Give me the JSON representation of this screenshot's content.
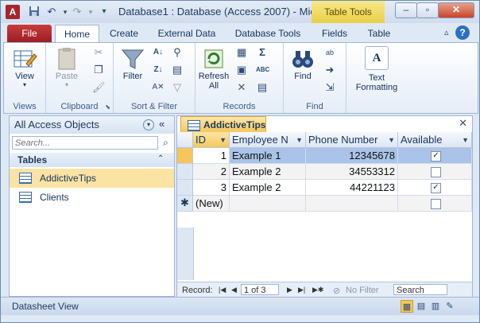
{
  "window": {
    "title": "Database1 : Database (Access 2007)  -  Mic...",
    "context_tab": "Table Tools",
    "app_icon": "A",
    "min_label": "–",
    "max_label": "▫",
    "close_label": "✕"
  },
  "qat": {
    "save_icon": "save-icon",
    "undo_icon": "undo-icon",
    "redo_icon": "redo-icon",
    "customize_icon": "customize-qat-icon"
  },
  "tabs": {
    "file": "File",
    "home": "Home",
    "create": "Create",
    "external": "External Data",
    "dbtools": "Database Tools",
    "fields": "Fields",
    "table": "Table"
  },
  "help_label": "?",
  "ribbon": {
    "views": {
      "view": "View",
      "label": "Views"
    },
    "clipboard": {
      "paste": "Paste",
      "label": "Clipboard"
    },
    "sortfilter": {
      "filter": "Filter",
      "label": "Sort & Filter"
    },
    "records": {
      "refresh": "Refresh All",
      "label": "Records"
    },
    "find": {
      "find": "Find",
      "label": "Find"
    },
    "textfmt": {
      "text_formatting": "Text Formatting",
      "a_label": "A"
    }
  },
  "nav": {
    "title": "All Access Objects",
    "search_placeholder": "Search...",
    "group": "Tables",
    "items": [
      {
        "label": "AddictiveTips"
      },
      {
        "label": "Clients"
      }
    ]
  },
  "datasheet": {
    "tab_label": "AddictiveTips",
    "columns": [
      "ID",
      "Employee N",
      "Phone Number",
      "Available"
    ],
    "rows": [
      {
        "id": "1",
        "name": "Example 1",
        "phone": "12345678",
        "available": true
      },
      {
        "id": "2",
        "name": "Example 2",
        "phone": "34553312",
        "available": false
      },
      {
        "id": "3",
        "name": "Example 2",
        "phone": "44221123",
        "available": true
      }
    ],
    "new_row": "(New)",
    "new_marker": "✱",
    "record_label": "Record:",
    "record_pos": "1 of 3",
    "no_filter": "No Filter",
    "search": "Search"
  },
  "status": {
    "text": "Datasheet View"
  }
}
